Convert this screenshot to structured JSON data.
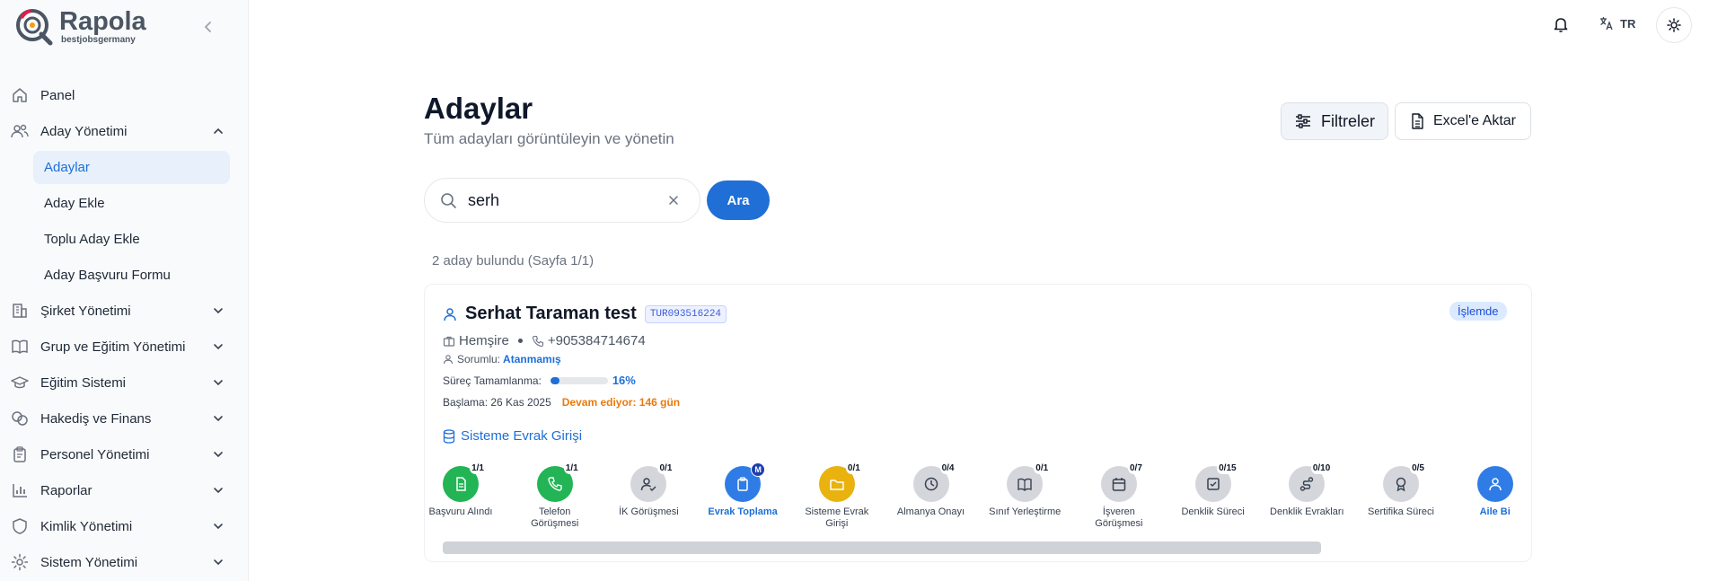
{
  "brand": {
    "title": "Rapola",
    "subtitle": "bestjobsgermany"
  },
  "sidebar": {
    "items": [
      {
        "label": "Panel",
        "icon": "home-icon"
      },
      {
        "label": "Aday Yönetimi",
        "icon": "users-icon",
        "expanded": true,
        "children": [
          "Adaylar",
          "Aday Ekle",
          "Toplu Aday Ekle",
          "Aday Başvuru Formu"
        ],
        "active_child": "Adaylar"
      },
      {
        "label": "Şirket Yönetimi",
        "icon": "building-icon"
      },
      {
        "label": "Grup ve Eğitim Yönetimi",
        "icon": "book-icon"
      },
      {
        "label": "Eğitim Sistemi",
        "icon": "graduation-cap-icon"
      },
      {
        "label": "Hakediş ve Finans",
        "icon": "coins-icon"
      },
      {
        "label": "Personel Yönetimi",
        "icon": "clipboard-icon"
      },
      {
        "label": "Raporlar",
        "icon": "bar-chart-icon"
      },
      {
        "label": "Kimlik Yönetimi",
        "icon": "shield-icon"
      },
      {
        "label": "Sistem Yönetimi",
        "icon": "gear-icon"
      }
    ]
  },
  "topbar": {
    "language": "TR"
  },
  "page": {
    "title": "Adaylar",
    "subtitle": "Tüm adayları görüntüleyin ve yönetin",
    "filter_label": "Filtreler",
    "excel_label": "Excel'e Aktar"
  },
  "search": {
    "value": "serh",
    "button_label": "Ara"
  },
  "results": {
    "summary": "2 aday bulundu (Sayfa 1/1)"
  },
  "candidate": {
    "name": "Serhat Taraman test",
    "code": "TUR093516224",
    "status": "İşlemde",
    "profession": "Hemşire",
    "phone": "+905384714674",
    "responsible_label": "Sorumlu:",
    "responsible_value": "Atanmamış",
    "progress_label": "Süreç Tamamlanma:",
    "progress_value": 16,
    "progress_text": "16%",
    "start_label": "Başlama: 26 Kas 2025",
    "ongoing_text": "Devam ediyor: 146 gün",
    "current_stage": "Sisteme Evrak Girişi"
  },
  "steps": [
    {
      "label": "Başvuru Alındı",
      "count": "1/1",
      "state": "done",
      "icon": "document-icon"
    },
    {
      "label": "Telefon Görüşmesi",
      "count": "1/1",
      "state": "done",
      "icon": "phone-icon"
    },
    {
      "label": "İK Görüşmesi",
      "count": "0/1",
      "state": "pending",
      "icon": "user-check-icon"
    },
    {
      "label": "Evrak Toplama",
      "count": "M",
      "state": "active",
      "icon": "clipboard-icon"
    },
    {
      "label": "Sisteme Evrak Girişi",
      "count": "0/1",
      "state": "warn",
      "icon": "folder-icon"
    },
    {
      "label": "Almanya Onayı",
      "count": "0/4",
      "state": "pending",
      "icon": "clock-icon"
    },
    {
      "label": "Sınıf Yerleştirme",
      "count": "0/1",
      "state": "pending",
      "icon": "book-icon"
    },
    {
      "label": "İşveren Görüşmesi",
      "count": "0/7",
      "state": "pending",
      "icon": "calendar-icon"
    },
    {
      "label": "Denklik Süreci",
      "count": "0/15",
      "state": "pending",
      "icon": "check-square-icon"
    },
    {
      "label": "Denklik Evrakları",
      "count": "0/10",
      "state": "pending",
      "icon": "route-icon"
    },
    {
      "label": "Sertifika Süreci",
      "count": "0/5",
      "state": "pending",
      "icon": "award-icon"
    },
    {
      "label": "Aile Bi",
      "count": "",
      "state": "active",
      "icon": "user-icon"
    }
  ],
  "colors": {
    "accent": "#1f6fd6",
    "done": "#22b455",
    "warn": "#e9b20e",
    "ongoing": "#ea7a0c"
  }
}
